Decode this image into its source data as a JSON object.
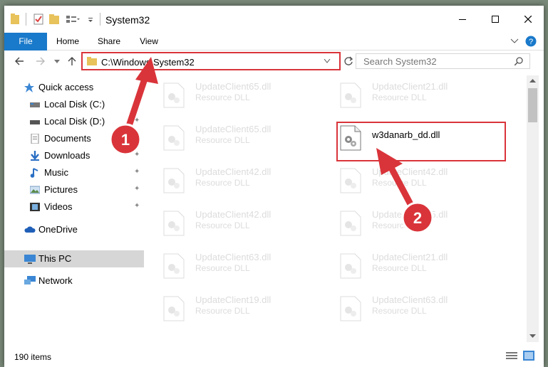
{
  "window": {
    "title": "System32"
  },
  "ribbon": {
    "tabs": [
      "File",
      "Home",
      "Share",
      "View"
    ]
  },
  "address": {
    "path": "C:\\Windows\\System32"
  },
  "search": {
    "placeholder": "Search System32"
  },
  "sidebar": {
    "items": [
      {
        "label": "Quick access"
      },
      {
        "label": "Local Disk (C:)"
      },
      {
        "label": "Local Disk (D:)"
      },
      {
        "label": "Documents"
      },
      {
        "label": "Downloads"
      },
      {
        "label": "Music"
      },
      {
        "label": "Pictures"
      },
      {
        "label": "Videos"
      },
      {
        "label": "OneDrive"
      },
      {
        "label": "This PC"
      },
      {
        "label": "Network"
      }
    ]
  },
  "files": {
    "left": [
      {
        "name": "UpdateClient65.dll",
        "type": "Resource DLL"
      },
      {
        "name": "UpdateClient65.dll",
        "type": "Resource DLL"
      },
      {
        "name": "UpdateClient42.dll",
        "type": "Resource DLL"
      },
      {
        "name": "UpdateClient42.dll",
        "type": "Resource DLL"
      },
      {
        "name": "UpdateClient63.dll",
        "type": "Resource DLL"
      },
      {
        "name": "UpdateClient19.dll",
        "type": "Resource DLL"
      }
    ],
    "right": [
      {
        "name": "UpdateClient21.dll",
        "type": "Resource DLL"
      },
      {
        "name": "w3danarb_dd.dll",
        "type": ""
      },
      {
        "name": "UpdateClient42.dll",
        "type": "Resource DLL"
      },
      {
        "name": "UpdateClient65.dll",
        "type": "Resource DLL"
      },
      {
        "name": "UpdateClient21.dll",
        "type": "Resource DLL"
      },
      {
        "name": "UpdateClient63.dll",
        "type": "Resource DLL"
      }
    ]
  },
  "status": {
    "items_count": "190 items"
  },
  "annotations": {
    "step1": "1",
    "step2": "2"
  },
  "colors": {
    "accent": "#1979ca",
    "highlight": "#d9343a"
  }
}
